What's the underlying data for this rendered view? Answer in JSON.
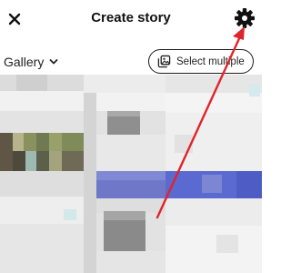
{
  "header": {
    "title": "Create story",
    "close_icon": "close-icon",
    "settings_icon": "gear-icon"
  },
  "toolbar": {
    "album_label": "Gallery",
    "album_icon": "chevron-down-icon",
    "select_multiple_label": "Select multiple",
    "select_multiple_icon": "multi-image-icon"
  },
  "colors": {
    "annotation_arrow": "#e0242b",
    "strip_blue": "#5b6ad0",
    "text": "#111111"
  }
}
